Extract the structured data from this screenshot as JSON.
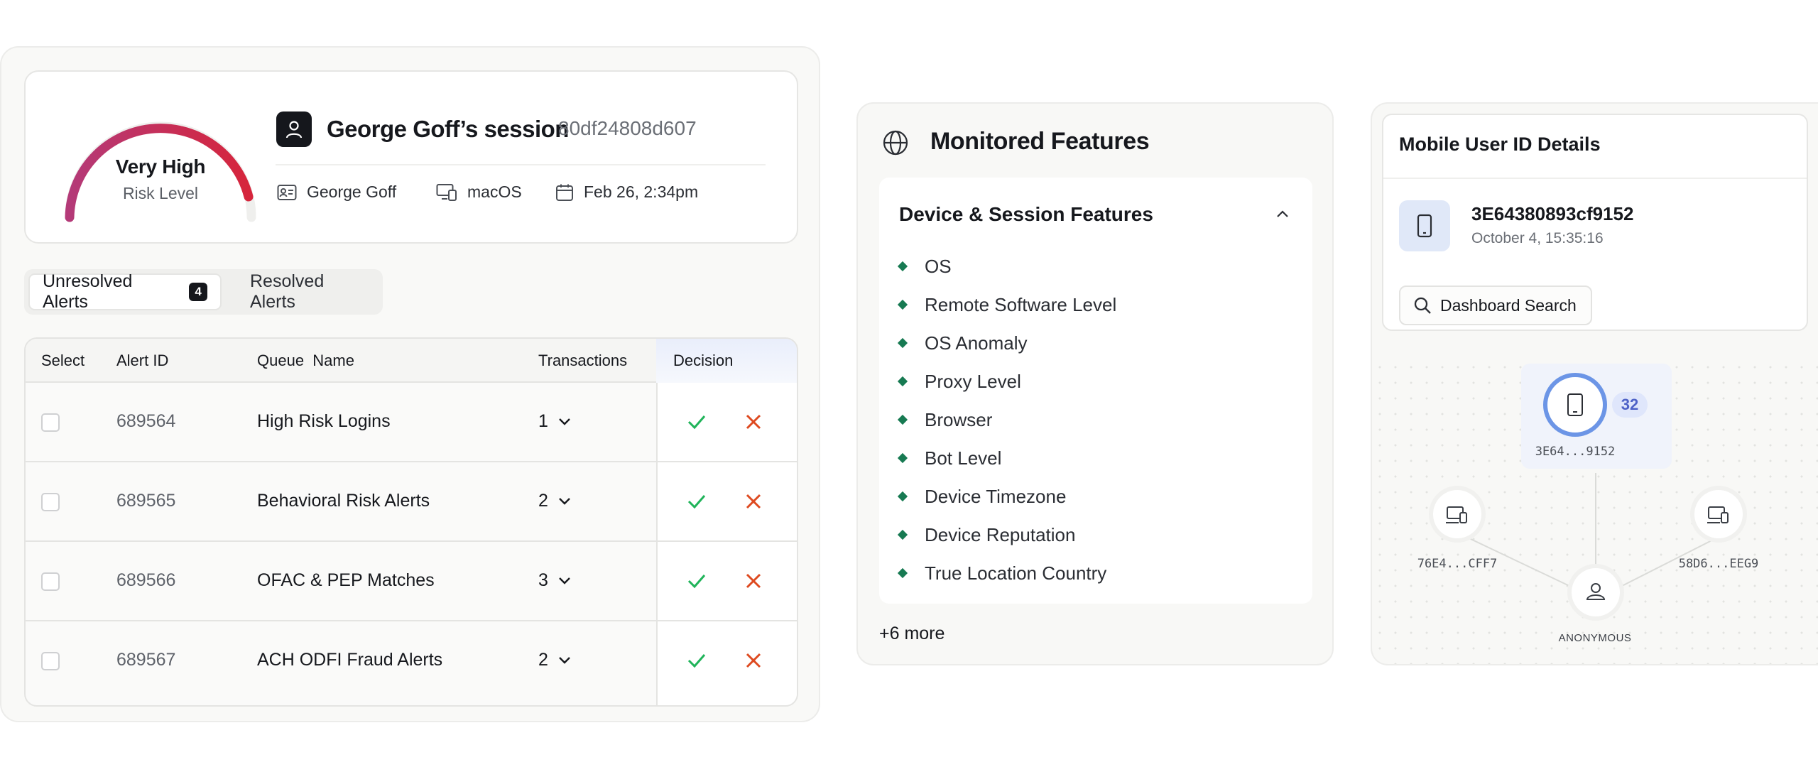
{
  "session": {
    "risk_title": "Very High",
    "risk_subtitle": "Risk Level",
    "risk_fraction": 0.95,
    "title": "George Goff’s session",
    "id": "80df24808d607",
    "user": "George Goff",
    "os": "macOS",
    "date": "Feb 26, 2:34pm"
  },
  "tabs": {
    "unresolved": "Unresolved Alerts",
    "unresolved_count": "4",
    "resolved": "Resolved Alerts"
  },
  "table": {
    "headers": {
      "select": "Select",
      "alert_id": "Alert ID",
      "queue": "Queue  Name",
      "transactions": "Transactions",
      "decision": "Decision"
    },
    "rows": [
      {
        "id": "689564",
        "queue": "High Risk Logins",
        "tx": "1"
      },
      {
        "id": "689565",
        "queue": "Behavioral Risk Alerts",
        "tx": "2"
      },
      {
        "id": "689566",
        "queue": "OFAC & PEP Matches",
        "tx": "3"
      },
      {
        "id": "689567",
        "queue": "ACH ODFI Fraud Alerts",
        "tx": "2"
      }
    ]
  },
  "features": {
    "title": "Monitored Features",
    "section": "Device & Session Features",
    "items": [
      "OS",
      "Remote Software Level",
      "OS Anomaly",
      "Proxy Level",
      "Browser",
      "Bot Level",
      "Device Timezone",
      "Device Reputation",
      "True Location Country"
    ],
    "more": "+6 more"
  },
  "mobile": {
    "title": "Mobile User ID Details",
    "id": "3E64380893cf9152",
    "date": "October 4, 15:35:16",
    "search_label": "Dashboard Search"
  },
  "graph": {
    "main_label": "3E64...9152",
    "main_count": "32",
    "left_label": "76E4...CFF7",
    "right_label": "58D6...EEG9",
    "center_label": "ANONYMOUS"
  },
  "colors": {
    "gauge_start": "#b43a78",
    "gauge_end": "#d6253c",
    "approve": "#20b45a",
    "reject": "#de4a20",
    "feature_bullet": "#177a52",
    "accent_blue": "#6c95e6"
  }
}
